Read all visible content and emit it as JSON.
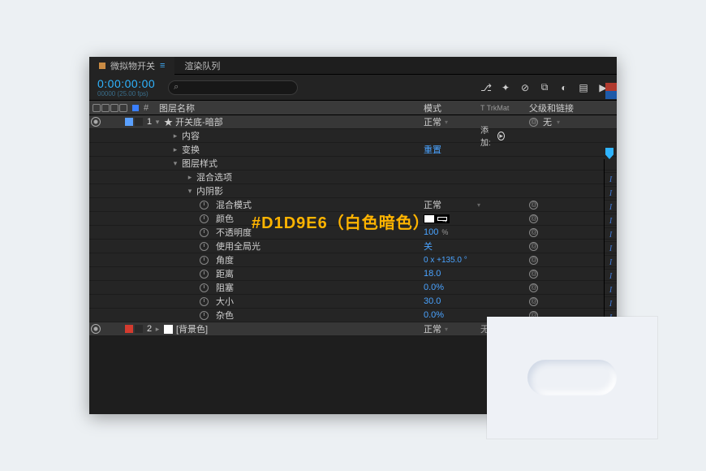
{
  "tabs": {
    "active": {
      "label": "微拟物开关",
      "close": "≡"
    },
    "other": "渲染队列"
  },
  "timecode": {
    "main": "0:00:00:00",
    "sub": "00000 (25.00 fps)"
  },
  "search": {
    "placeholder": ""
  },
  "headers": {
    "hash": "#",
    "layerName": "图层名称",
    "mode": "模式",
    "trkmat": "T  TrkMat",
    "parent": "父级和链接"
  },
  "layers": [
    {
      "index": "1",
      "swatch1": "#5aa0ff",
      "swatch2": "#2a2a2a",
      "name": "★ 开关底-暗部",
      "mode": "正常",
      "parent": "无"
    },
    {
      "index": "2",
      "swatch1": "#d43b2f",
      "swatch2": "#2a2a2a",
      "name": "[背景色]",
      "nameSwatch": "#ffffff",
      "mode": "正常",
      "trk": "无"
    }
  ],
  "groups": {
    "contents": "内容",
    "transform": "变换",
    "transformReset": "重置",
    "layerStyles": "图层样式",
    "blendOptions": "混合选项",
    "innerShadow": "内阴影"
  },
  "props": {
    "blendMode": {
      "label": "混合模式",
      "value": "正常"
    },
    "color": {
      "label": "颜色",
      "swatch1": "#ffffff",
      "swatch2": "#000000"
    },
    "opacity": {
      "label": "不透明度",
      "value": "100",
      "unit": "%"
    },
    "useGlobal": {
      "label": "使用全局光",
      "value": "关"
    },
    "angle": {
      "label": "角度",
      "value": "0 x  +135.0 °"
    },
    "distance": {
      "label": "距离",
      "value": "18.0"
    },
    "choke": {
      "label": "阻塞",
      "value": "0.0%"
    },
    "size": {
      "label": "大小",
      "value": "30.0"
    },
    "noise": {
      "label": "杂色",
      "value": "0.0%"
    }
  },
  "add": {
    "label": "添加:"
  },
  "annotation": "#D1D9E6（白色暗色）",
  "chips": [
    "#b03a2e",
    "#1f7a3e",
    "#1e5aa8"
  ]
}
